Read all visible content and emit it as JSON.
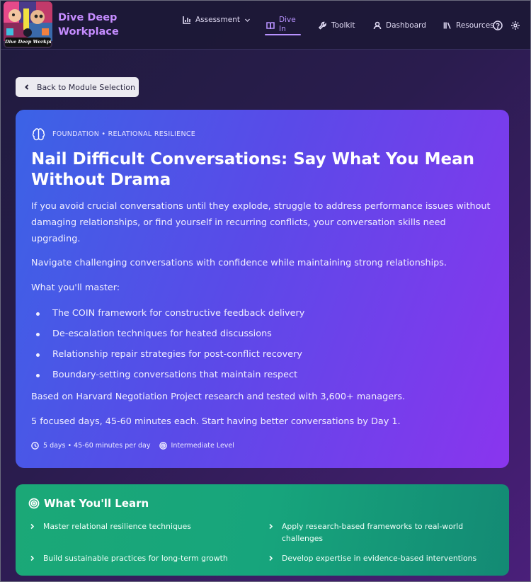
{
  "app": {
    "logo_caption": "Dive Deep Workplace",
    "brand_line1": "Dive Deep",
    "brand_line2": "Workplace"
  },
  "nav": {
    "assessment": "Assessment",
    "dive_line1": "Dive",
    "dive_line2": "In",
    "toolkit": "Toolkit",
    "dashboard": "Dashboard",
    "resources": "Resources"
  },
  "back": {
    "label": "Back to Module Selection"
  },
  "hero": {
    "eyebrow": "FOUNDATION • RELATIONAL RESILIENCE",
    "title": "Nail Difficult Conversations: Say What You Mean Without Drama",
    "intro": "If you avoid crucial conversations until they explode, struggle to address performance issues without damaging relationships, or find yourself in recurring conflicts, your conversation skills need upgrading.",
    "tagline": "Navigate challenging conversations with confidence while maintaining strong relationships.",
    "master_heading": "What you'll master:",
    "bullets": [
      "The COIN framework for constructive feedback delivery",
      "De-escalation techniques for heated discussions",
      "Relationship repair strategies for post-conflict recovery",
      "Boundary-setting conversations that maintain respect"
    ],
    "research": "Based on Harvard Negotiation Project research and tested with 3,600+ managers.",
    "schedule": "5 focused days, 45-60 minutes each. Start having better conversations by Day 1.",
    "meta_duration": "5 days • 45-60 minutes per day",
    "meta_level": "Intermediate Level"
  },
  "learn": {
    "title": "What You'll Learn",
    "items": [
      "Master relational resilience techniques",
      "Apply research-based frameworks to real-world challenges",
      "Build sustainable practices for long-term growth",
      "Develop expertise in evidence-based interventions"
    ]
  },
  "colors": {
    "brand": "#c58cff",
    "nav_active": "#b892ff",
    "hero_start": "#3b63e6",
    "hero_end": "#8a35ee",
    "learn_bg": "#17a57c"
  }
}
